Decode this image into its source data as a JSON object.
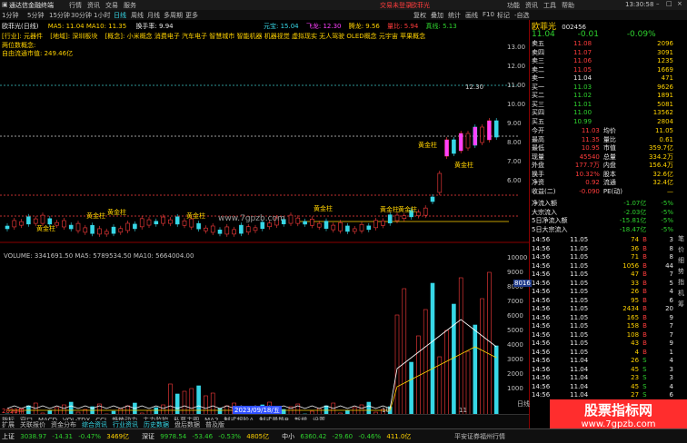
{
  "window": {
    "title": "通达信金融终端",
    "top_menu": [
      "行情",
      "资讯",
      "交易",
      "服务"
    ],
    "promo": "交易未登录",
    "stock_header": "欧菲光",
    "right_menu": [
      "功能",
      "资讯",
      "工具",
      "帮助"
    ],
    "clock": "13:30:58"
  },
  "toolbar": {
    "periods": [
      "1分钟",
      "5分钟",
      "15分钟",
      "30分钟",
      "1小时",
      "日线",
      "周线",
      "月线",
      "多周期",
      "更多"
    ],
    "buttons": [
      "复权",
      "叠加",
      "统计",
      "画线",
      "F10",
      "标记",
      "-自选",
      "返回"
    ]
  },
  "chart_header": {
    "left": "欧菲光(日线)",
    "indicator": "MA5: 11.04  MA10: 11.35",
    "info_labels": [
      "换手率: 9.94",
      "概念: 消费电子"
    ],
    "tags": [
      "[行业]: 元器件",
      "[地域]: 深圳板块",
      "[概念]: 小米概念 消费电子 汽车电子 智慧城市 智能机器 机器视觉 虚拟现实 无人驾驶 OLED概念 元宇宙 苹果概念"
    ],
    "label1": "两位数概念:",
    "label2": "自由流通市值: 249.46亿",
    "price_max": "12.30",
    "right_labels": [
      "元宝: 15.04",
      "飞龙: 12.30",
      "腾龙: 9.56",
      "量比: 5.94",
      "真线: 5.13"
    ]
  },
  "annotations": [
    "黄金柱",
    "黄金柱",
    "黄金柱",
    "黄金柱",
    "黄金柱",
    "黄金柱",
    "黄金柱",
    "黄金柱",
    "黄金柱"
  ],
  "watermark": "www.7gpzb.com",
  "price_axis": [
    "13.00",
    "12.00",
    "11.00",
    "10.00",
    "9.00",
    "8.00",
    "7.00",
    "6.00"
  ],
  "volume_header": "VOLUME: 3341691.50  MA5: 5789534.50  MA10: 5664004.00",
  "volume_axis": [
    "10000",
    "9000",
    "8000",
    "7000",
    "6000",
    "5000",
    "4000",
    "3000",
    "2000",
    "1000"
  ],
  "date_axis": [
    "2023年",
    "10",
    "11"
  ],
  "bottom_tabs": [
    "指标",
    "窗口",
    "MACD",
    "VOL-TDX",
    "CCI",
    "趋势动力",
    "主力监控",
    "私募主图",
    "MA2",
    "制式超阶A",
    "制式量能B",
    "新增",
    "设置"
  ],
  "bottom_tabs2": [
    "扩展",
    "关联报价",
    "资金分布",
    "综合资讯",
    "行业资讯",
    "历史数据",
    "盘后数据",
    "普及版"
  ],
  "highlight_date": "2023/09/18/五",
  "right": {
    "name": "欧菲光",
    "code": "002456",
    "price": "11.04",
    "change": "-0.01",
    "pct": "-0.09%",
    "order_book": [
      {
        "label": "卖五",
        "price": "11.08",
        "vol": "2096"
      },
      {
        "label": "卖四",
        "price": "11.07",
        "vol": "3091"
      },
      {
        "label": "卖三",
        "price": "11.06",
        "vol": "1235"
      },
      {
        "label": "卖二",
        "price": "11.05",
        "vol": "1669"
      },
      {
        "label": "卖一",
        "price": "11.04",
        "vol": "471"
      },
      {
        "label": "买一",
        "price": "11.03",
        "vol": "9626"
      },
      {
        "label": "买二",
        "price": "11.02",
        "vol": "1891"
      },
      {
        "label": "买三",
        "price": "11.01",
        "vol": "5081"
      },
      {
        "label": "买四",
        "price": "11.00",
        "vol": "13562"
      },
      {
        "label": "买五",
        "price": "10.99",
        "vol": "2804"
      }
    ],
    "stats": [
      {
        "l1": "今开",
        "v1": "11.03",
        "l2": "均价",
        "v2": "11.05"
      },
      {
        "l1": "最高",
        "v1": "11.35",
        "l2": "量比",
        "v2": "0.61"
      },
      {
        "l1": "最低",
        "v1": "10.95",
        "l2": "市值",
        "v2": "359.7亿"
      },
      {
        "l1": "现量",
        "v1": "45540",
        "l2": "总量",
        "v2": "334.2万"
      },
      {
        "l1": "外盘",
        "v1": "177.7万",
        "l2": "内盘",
        "v2": "156.4万"
      },
      {
        "l1": "换手",
        "v1": "10.32%",
        "l2": "股本",
        "v2": "32.6亿"
      },
      {
        "l1": "净资",
        "v1": "0.92",
        "l2": "流通",
        "v2": "32.4亿"
      },
      {
        "l1": "收益(二)",
        "v1": "-0.090",
        "l2": "PE(动)",
        "v2": "—"
      }
    ],
    "flows": [
      {
        "label": "净流入额",
        "v": "-1.07亿",
        "p": "-5%"
      },
      {
        "label": "大宗流入",
        "v": "-2.03亿",
        "p": "-5%"
      },
      {
        "label": "5日净流入额",
        "v": "-15.81亿",
        "p": "-5%"
      },
      {
        "label": "5日大宗流入",
        "v": "-18.47亿",
        "p": "-5%"
      }
    ],
    "ticks": [
      {
        "t": "14:56",
        "p": "11.05",
        "v": "74",
        "s": "B",
        "n": "3"
      },
      {
        "t": "14:56",
        "p": "11.05",
        "v": "36",
        "s": "B",
        "n": "8"
      },
      {
        "t": "14:56",
        "p": "11.05",
        "v": "71",
        "s": "B",
        "n": "8"
      },
      {
        "t": "14:56",
        "p": "11.05",
        "v": "1056",
        "s": "B",
        "n": "44"
      },
      {
        "t": "14:56",
        "p": "11.05",
        "v": "47",
        "s": "B",
        "n": "7"
      },
      {
        "t": "14:56",
        "p": "11.05",
        "v": "33",
        "s": "B",
        "n": "5"
      },
      {
        "t": "14:56",
        "p": "11.05",
        "v": "26",
        "s": "B",
        "n": "4"
      },
      {
        "t": "14:56",
        "p": "11.05",
        "v": "95",
        "s": "B",
        "n": "6"
      },
      {
        "t": "14:56",
        "p": "11.05",
        "v": "2434",
        "s": "B",
        "n": "20"
      },
      {
        "t": "14:56",
        "p": "11.05",
        "v": "165",
        "s": "B",
        "n": "9"
      },
      {
        "t": "14:56",
        "p": "11.05",
        "v": "158",
        "s": "B",
        "n": "7"
      },
      {
        "t": "14:56",
        "p": "11.05",
        "v": "108",
        "s": "B",
        "n": "7"
      },
      {
        "t": "14:56",
        "p": "11.05",
        "v": "43",
        "s": "B",
        "n": "9"
      },
      {
        "t": "14:56",
        "p": "11.05",
        "v": "4",
        "s": "B",
        "n": "1"
      },
      {
        "t": "14:56",
        "p": "11.04",
        "v": "26",
        "s": "S",
        "n": "4"
      },
      {
        "t": "14:56",
        "p": "11.04",
        "v": "45",
        "s": "S",
        "n": "3"
      },
      {
        "t": "14:56",
        "p": "11.04",
        "v": "23",
        "s": "S",
        "n": "3"
      },
      {
        "t": "14:56",
        "p": "11.04",
        "v": "45",
        "s": "S",
        "n": "4"
      },
      {
        "t": "14:56",
        "p": "11.04",
        "v": "27",
        "s": "S",
        "n": "6"
      }
    ],
    "side_tab": "8016",
    "section_label": "日线",
    "right_tabs": [
      "笔",
      "价",
      "细",
      "势",
      "指",
      "机",
      "筹"
    ]
  },
  "status": {
    "items": [
      {
        "name": "上证",
        "value": "3038.97",
        "change": "-14.31",
        "pct": "-0.47%",
        "amount": "3469亿"
      },
      {
        "name": "深证",
        "value": "9978.54",
        "change": "-53.46",
        "pct": "-0.53%",
        "amount": "4805亿"
      },
      {
        "name": "中小",
        "value": "6360.42",
        "change": "-29.60",
        "pct": "-0.46%",
        "amount": "411.0亿"
      }
    ],
    "right": "平安证券福州行情"
  },
  "ad": {
    "line1": "股票指标网",
    "line2": "www.7gpzb.com"
  }
}
